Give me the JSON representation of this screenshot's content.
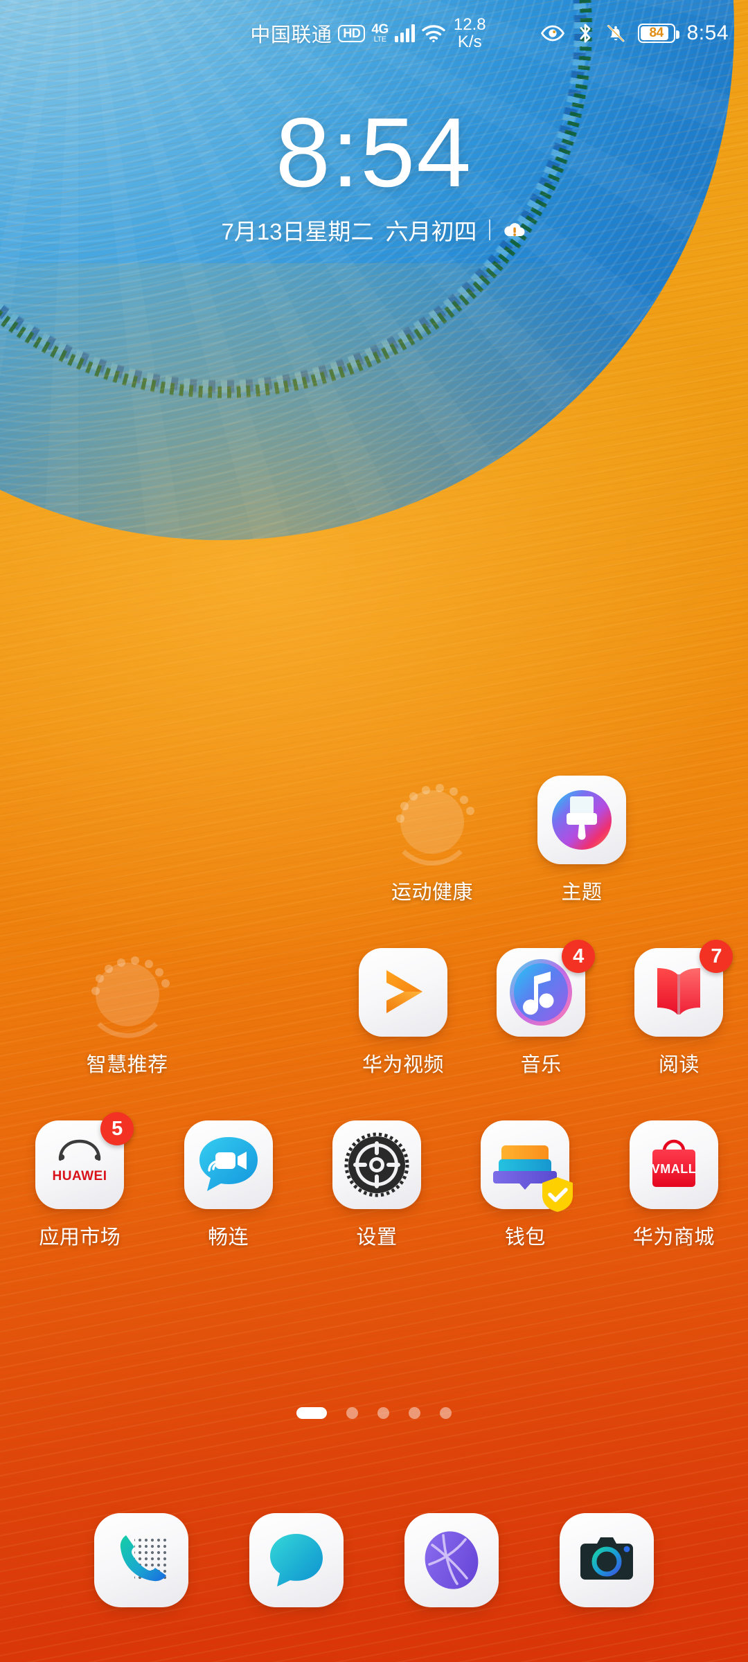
{
  "status_bar": {
    "carrier": "中国联通",
    "hd_badge": "HD",
    "network_type": "4G",
    "network_sub": "LTE",
    "signal_icon": "signal-bars-icon",
    "wifi_icon": "wifi-icon",
    "net_speed_value": "12.8",
    "net_speed_unit": "K/s",
    "eye_comfort_icon": "eye-icon",
    "bluetooth_icon": "bluetooth-icon",
    "silent_icon": "bell-muted-icon",
    "battery_percent": "84",
    "time": "8:54"
  },
  "clock_widget": {
    "time": "8:54",
    "date": "7月13日星期二",
    "lunar_date": "六月初四",
    "weather_icon": "cloud-alert-icon"
  },
  "grid": {
    "rows": [
      {
        "cells": [
          {
            "label": "",
            "icon": "empty-slot",
            "badge": ""
          },
          {
            "label": "",
            "icon": "empty-slot",
            "badge": ""
          },
          {
            "label": "运动健康",
            "icon": "placeholder-icon",
            "badge": ""
          },
          {
            "label": "主题",
            "icon": "themes-icon",
            "badge": ""
          }
        ]
      },
      {
        "cells": [
          {
            "label": "智慧推荐",
            "icon": "placeholder-icon",
            "badge": ""
          },
          {
            "label": "",
            "icon": "empty-slot",
            "badge": ""
          },
          {
            "label": "华为视频",
            "icon": "huawei-video-icon",
            "badge": ""
          },
          {
            "label": "音乐",
            "icon": "music-icon",
            "badge": "4"
          },
          {
            "label": "阅读",
            "icon": "reader-icon",
            "badge": "7"
          }
        ]
      },
      {
        "cells": [
          {
            "label": "应用市场",
            "icon": "appgallery-icon",
            "badge": "5"
          },
          {
            "label": "畅连",
            "icon": "meetime-icon",
            "badge": ""
          },
          {
            "label": "设置",
            "icon": "settings-gear-icon",
            "badge": ""
          },
          {
            "label": "钱包",
            "icon": "wallet-icon",
            "badge": "",
            "check_badge": true
          },
          {
            "label": "华为商城",
            "icon": "vmall-icon",
            "badge": ""
          }
        ]
      }
    ],
    "appgallery_wordmark": "HUAWEI",
    "vmall_wordmark": "VMALL"
  },
  "page_indicator": {
    "total": 5,
    "active_index": 0
  },
  "dock": {
    "items": [
      {
        "label": "",
        "icon": "phone-icon"
      },
      {
        "label": "",
        "icon": "messages-icon"
      },
      {
        "label": "",
        "icon": "browser-icon"
      },
      {
        "label": "",
        "icon": "camera-icon"
      }
    ]
  },
  "colors": {
    "wallpaper_top": "#f0a017",
    "wallpaper_bottom": "#d93408",
    "blob_blue": "#2a90d8",
    "badge_red": "#f43224",
    "check_yellow": "#ffd000"
  }
}
